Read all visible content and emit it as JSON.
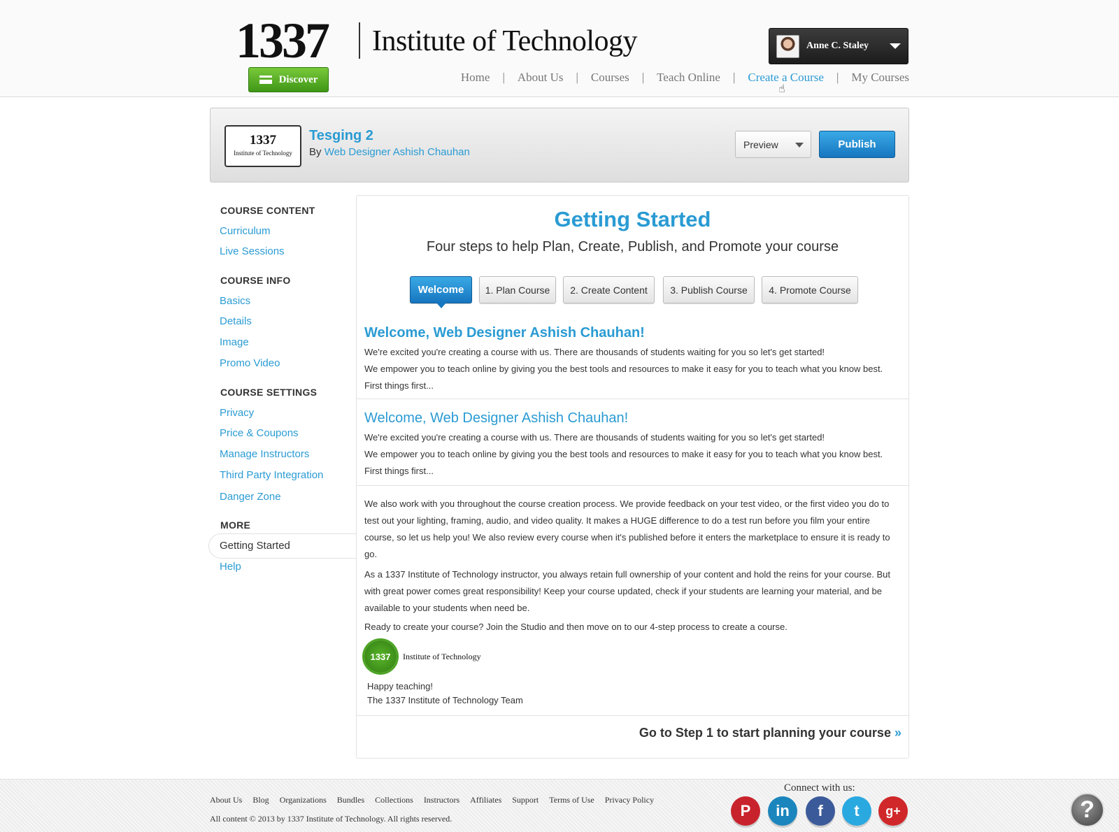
{
  "header": {
    "logo_number": "1337",
    "logo_text": "Institute of Technology",
    "discover_label": "Discover",
    "user": {
      "name": "Anne C. Staley"
    },
    "nav": [
      {
        "label": "Home"
      },
      {
        "label": "About Us"
      },
      {
        "label": "Courses"
      },
      {
        "label": "Teach Online"
      },
      {
        "label": "Create a Course",
        "active": true
      },
      {
        "label": "My Courses"
      }
    ],
    "nav_separator": "|"
  },
  "course": {
    "logo_number": "1337",
    "logo_text": "Institute of Technology",
    "title": "Tesging 2",
    "by_prefix": "By",
    "author": "Web Designer Ashish Chauhan",
    "preview_label": "Preview",
    "publish_label": "Publish"
  },
  "sidebar": {
    "sections": [
      {
        "heading": "COURSE CONTENT",
        "items": [
          "Curriculum",
          "Live Sessions"
        ]
      },
      {
        "heading": "COURSE INFO",
        "items": [
          "Basics",
          "Details",
          "Image",
          "Promo Video"
        ]
      },
      {
        "heading": "COURSE SETTINGS",
        "items": [
          "Privacy",
          "Price & Coupons",
          "Manage Instructors",
          "Third Party Integration",
          "Danger Zone"
        ]
      },
      {
        "heading": "MORE",
        "items": [
          "Getting Started",
          "Help"
        ]
      }
    ],
    "active_item": "Getting Started"
  },
  "main": {
    "title": "Getting Started",
    "subtitle": "Four steps to help Plan, Create, Publish, and Promote your course",
    "tabs": [
      {
        "label": "Welcome",
        "active": true
      },
      {
        "label": "1. Plan Course"
      },
      {
        "label": "2. Create Content"
      },
      {
        "label": "3. Publish Course"
      },
      {
        "label": "4. Promote Course"
      }
    ],
    "welcome_heading_1": "Welcome, Web Designer Ashish Chauhan!",
    "welcome_text_1a": "We're excited you're creating a course with us. There are thousands of students waiting for you so let's get started!",
    "welcome_text_1b": "We empower you to teach online by giving you the best tools and resources to make it easy for you to teach what you know best. First things first...",
    "welcome_heading_2": "Welcome, Web Designer Ashish Chauhan!",
    "welcome_text_2a": "We're excited you're creating a course with us. There are thousands of students waiting for you so let's get started!",
    "welcome_text_2b": "We empower you to teach online by giving you the best tools and resources to make it easy for you to teach what you know best. First things first...",
    "para_1": "We also work with you throughout the course creation process. We provide feedback on your test video, or the first video you do to test out your lighting, framing, audio, and video quality. It makes a HUGE difference to do a test run before you film your entire course, so let us help you! We also review every course when it's published before it enters the marketplace to ensure it is ready to go.",
    "para_2": "As a 1337 Institute of Technology instructor, you always retain full ownership of your content and hold the reins for your course. But with great power comes great responsibility! Keep your course updated, check if your students are learning your material, and be available to your students when need be.",
    "para_3": "Ready to create your course? Join the Studio and then move on to our 4-step process to create a course.",
    "seal_number": "1337",
    "seal_text": "Institute of Technology",
    "sign_1": "Happy teaching!",
    "sign_2": "The 1337 Institute of Technology Team",
    "go_step_label": "Go to Step 1 to start planning your course",
    "go_step_arrow": "»"
  },
  "footer": {
    "links": [
      "About Us",
      "Blog",
      "Organizations",
      "Bundles",
      "Collections",
      "Instructors",
      "Affiliates",
      "Support",
      "Terms of Use",
      "Privacy Policy"
    ],
    "copyright": "All content © 2013 by 1337 Institute of Technology. All rights reserved.",
    "connect_label": "Connect with us:",
    "social": [
      {
        "icon": "pinterest-icon",
        "glyph": "P",
        "color": "#c8232c"
      },
      {
        "icon": "linkedin-icon",
        "glyph": "in",
        "color": "#1b86bd"
      },
      {
        "icon": "facebook-icon",
        "glyph": "f",
        "color": "#3b5a9a"
      },
      {
        "icon": "twitter-icon",
        "glyph": "t",
        "color": "#2aa9e0"
      },
      {
        "icon": "google-plus-icon",
        "glyph": "g+",
        "color": "#d0282a"
      }
    ],
    "help_glyph": "?"
  },
  "colors": {
    "accent": "#2a9bd3",
    "publish": "#1676bf",
    "discover": "#4fa620"
  }
}
